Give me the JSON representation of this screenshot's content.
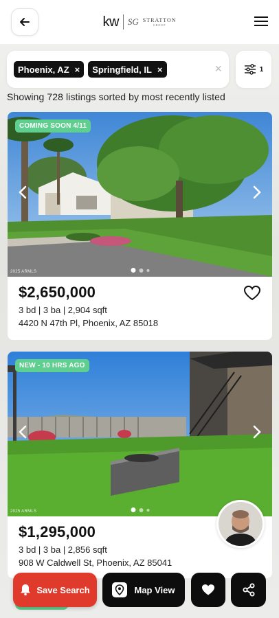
{
  "header": {
    "logo_kw": "kw",
    "logo_sg": "SG",
    "logo_stratton": "STRATTON",
    "logo_group": "GROUP"
  },
  "search": {
    "chips": [
      {
        "label": "Phoenix, AZ",
        "remove": "×"
      },
      {
        "label": "Springfield, IL",
        "remove": "×"
      }
    ],
    "clear": "×",
    "filter_count": "1"
  },
  "results_text": "Showing 728 listings sorted by most recently listed",
  "listings": [
    {
      "badge": "COMING SOON 4/11",
      "watermark": "2025 ARMLS",
      "price": "$2,650,000",
      "specs": "3 bd | 3 ba | 2,904 sqft",
      "address": "4420 N 47th Pl, Phoenix, AZ 85018"
    },
    {
      "badge": "NEW - 10 HRS AGO",
      "watermark": "2025 ARMLS",
      "price": "$1,295,000",
      "specs": "3 bd | 3 ba | 2,856 sqft",
      "address": "908 W Caldwell St, Phoenix, AZ 85041"
    }
  ],
  "bottom_bar": {
    "save_search": "Save Search",
    "map_view": "Map View"
  },
  "colors": {
    "accent_red": "#e03a2d",
    "badge_green": "#5fcf8f",
    "dark": "#0d0d0d"
  },
  "icons": [
    "back-arrow-icon",
    "hamburger-menu-icon",
    "filter-sliders-icon",
    "heart-outline-icon",
    "bell-icon",
    "map-pin-icon",
    "heart-filled-icon",
    "share-icon",
    "chevron-left-icon",
    "chevron-right-icon"
  ]
}
